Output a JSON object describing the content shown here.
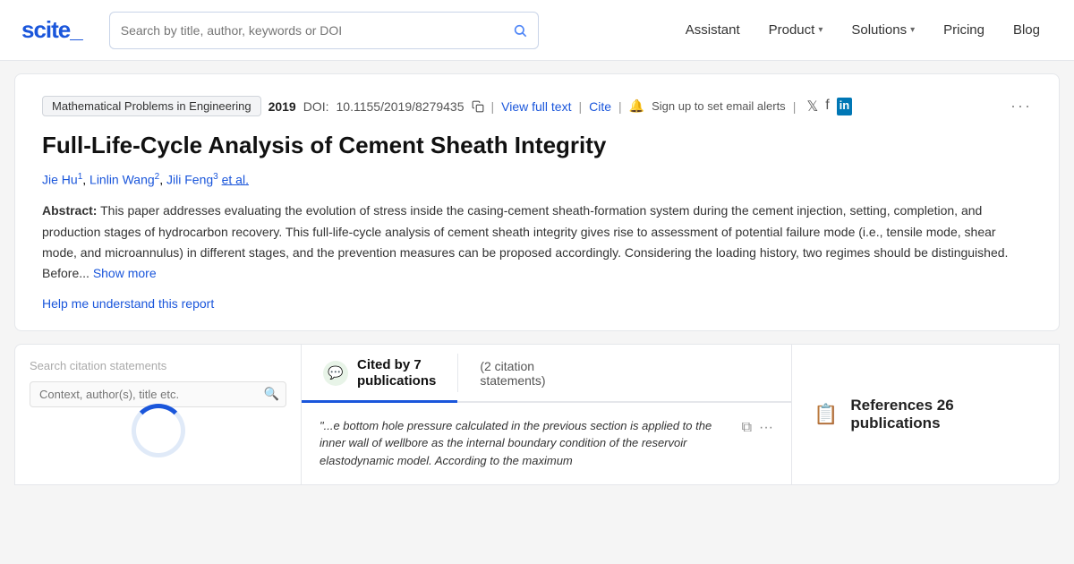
{
  "navbar": {
    "logo": "scite_",
    "search_placeholder": "Search by title, author, keywords or DOI",
    "nav_items": [
      {
        "id": "assistant",
        "label": "Assistant",
        "has_dropdown": false
      },
      {
        "id": "product",
        "label": "Product",
        "has_dropdown": true
      },
      {
        "id": "solutions",
        "label": "Solutions",
        "has_dropdown": true
      },
      {
        "id": "pricing",
        "label": "Pricing",
        "has_dropdown": false
      },
      {
        "id": "blog",
        "label": "Blog",
        "has_dropdown": false
      }
    ]
  },
  "article": {
    "journal": "Mathematical Problems in Engineering",
    "year": "2019",
    "doi_label": "DOI:",
    "doi_value": "10.1155/2019/8279435",
    "view_full_text": "View full text",
    "cite": "Cite",
    "signup_text": "Sign up to set email alerts",
    "title": "Full-Life-Cycle Analysis of Cement Sheath Integrity",
    "authors": [
      {
        "name": "Jie Hu",
        "sup": "1"
      },
      {
        "name": "Linlin Wang",
        "sup": "2"
      },
      {
        "name": "Jili Feng",
        "sup": "3"
      }
    ],
    "et_al": "et al.",
    "abstract_label": "Abstract:",
    "abstract_text": "This paper addresses evaluating the evolution of stress inside the casing-cement sheath-formation system during the cement injection, setting, completion, and production stages of hydrocarbon recovery. This full-life-cycle analysis of cement sheath integrity gives rise to assessment of potential failure mode (i.e., tensile mode, shear mode, and microannulus) in different stages, and the prevention measures can be proposed accordingly. Considering the loading history, two regimes should be distinguished. Before...",
    "show_more": "Show more",
    "help_link": "Help me understand this report"
  },
  "bottom": {
    "search_citations_label": "Search citation statements",
    "search_citations_placeholder": "Context, author(s), title etc.",
    "cited_by_label": "Cited by 7",
    "cited_by_line2": "publications",
    "citation_count_label": "(2 citation",
    "citation_count_line2": "statements)",
    "references_label": "References 26 publications",
    "citation_snippet": "\"...e bottom hole pressure calculated in the previous section is applied to the inner wall of wellbore as the internal boundary condition of the reservoir elastodynamic model. According to the maximum"
  }
}
